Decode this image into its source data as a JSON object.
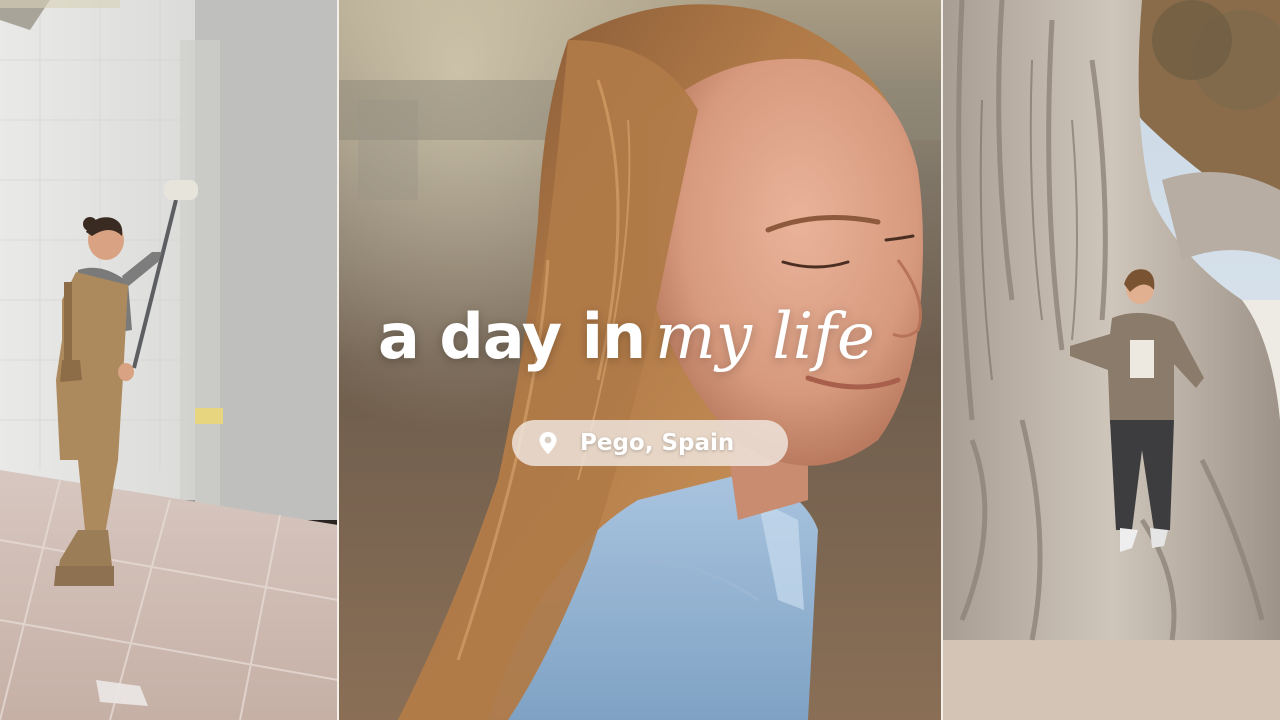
{
  "title": {
    "part1": "a day in",
    "part2": "my life"
  },
  "location": {
    "text": "Pego, Spain",
    "icon": "map-pin-icon"
  },
  "panels": {
    "left": "woman painting wall with roller",
    "center": "woman with long hair in denim shirt, eyes closed, smiling",
    "right": "woman standing against large banyan tree roots"
  },
  "colors": {
    "title_text": "#ffffff",
    "pill_background": "#f0e8e0",
    "divider": "#f4efe9"
  }
}
